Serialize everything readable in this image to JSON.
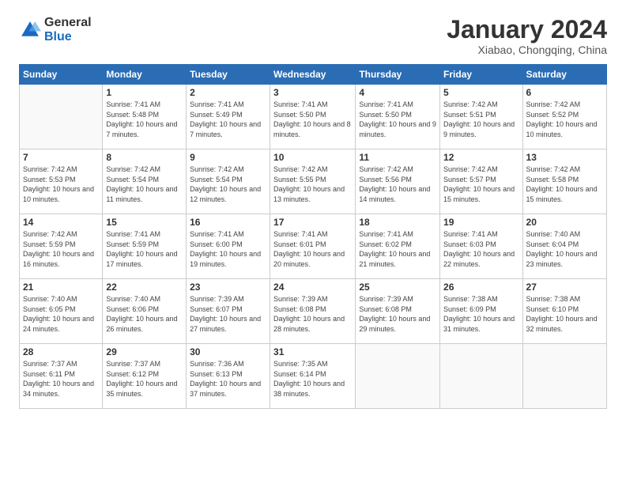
{
  "logo": {
    "general": "General",
    "blue": "Blue"
  },
  "title": "January 2024",
  "subtitle": "Xiabao, Chongqing, China",
  "days_header": [
    "Sunday",
    "Monday",
    "Tuesday",
    "Wednesday",
    "Thursday",
    "Friday",
    "Saturday"
  ],
  "weeks": [
    [
      {
        "day": "",
        "sunrise": "",
        "sunset": "",
        "daylight": ""
      },
      {
        "day": "1",
        "sunrise": "Sunrise: 7:41 AM",
        "sunset": "Sunset: 5:48 PM",
        "daylight": "Daylight: 10 hours and 7 minutes."
      },
      {
        "day": "2",
        "sunrise": "Sunrise: 7:41 AM",
        "sunset": "Sunset: 5:49 PM",
        "daylight": "Daylight: 10 hours and 7 minutes."
      },
      {
        "day": "3",
        "sunrise": "Sunrise: 7:41 AM",
        "sunset": "Sunset: 5:50 PM",
        "daylight": "Daylight: 10 hours and 8 minutes."
      },
      {
        "day": "4",
        "sunrise": "Sunrise: 7:41 AM",
        "sunset": "Sunset: 5:50 PM",
        "daylight": "Daylight: 10 hours and 9 minutes."
      },
      {
        "day": "5",
        "sunrise": "Sunrise: 7:42 AM",
        "sunset": "Sunset: 5:51 PM",
        "daylight": "Daylight: 10 hours and 9 minutes."
      },
      {
        "day": "6",
        "sunrise": "Sunrise: 7:42 AM",
        "sunset": "Sunset: 5:52 PM",
        "daylight": "Daylight: 10 hours and 10 minutes."
      }
    ],
    [
      {
        "day": "7",
        "sunrise": "Sunrise: 7:42 AM",
        "sunset": "Sunset: 5:53 PM",
        "daylight": "Daylight: 10 hours and 10 minutes."
      },
      {
        "day": "8",
        "sunrise": "Sunrise: 7:42 AM",
        "sunset": "Sunset: 5:54 PM",
        "daylight": "Daylight: 10 hours and 11 minutes."
      },
      {
        "day": "9",
        "sunrise": "Sunrise: 7:42 AM",
        "sunset": "Sunset: 5:54 PM",
        "daylight": "Daylight: 10 hours and 12 minutes."
      },
      {
        "day": "10",
        "sunrise": "Sunrise: 7:42 AM",
        "sunset": "Sunset: 5:55 PM",
        "daylight": "Daylight: 10 hours and 13 minutes."
      },
      {
        "day": "11",
        "sunrise": "Sunrise: 7:42 AM",
        "sunset": "Sunset: 5:56 PM",
        "daylight": "Daylight: 10 hours and 14 minutes."
      },
      {
        "day": "12",
        "sunrise": "Sunrise: 7:42 AM",
        "sunset": "Sunset: 5:57 PM",
        "daylight": "Daylight: 10 hours and 15 minutes."
      },
      {
        "day": "13",
        "sunrise": "Sunrise: 7:42 AM",
        "sunset": "Sunset: 5:58 PM",
        "daylight": "Daylight: 10 hours and 15 minutes."
      }
    ],
    [
      {
        "day": "14",
        "sunrise": "Sunrise: 7:42 AM",
        "sunset": "Sunset: 5:59 PM",
        "daylight": "Daylight: 10 hours and 16 minutes."
      },
      {
        "day": "15",
        "sunrise": "Sunrise: 7:41 AM",
        "sunset": "Sunset: 5:59 PM",
        "daylight": "Daylight: 10 hours and 17 minutes."
      },
      {
        "day": "16",
        "sunrise": "Sunrise: 7:41 AM",
        "sunset": "Sunset: 6:00 PM",
        "daylight": "Daylight: 10 hours and 19 minutes."
      },
      {
        "day": "17",
        "sunrise": "Sunrise: 7:41 AM",
        "sunset": "Sunset: 6:01 PM",
        "daylight": "Daylight: 10 hours and 20 minutes."
      },
      {
        "day": "18",
        "sunrise": "Sunrise: 7:41 AM",
        "sunset": "Sunset: 6:02 PM",
        "daylight": "Daylight: 10 hours and 21 minutes."
      },
      {
        "day": "19",
        "sunrise": "Sunrise: 7:41 AM",
        "sunset": "Sunset: 6:03 PM",
        "daylight": "Daylight: 10 hours and 22 minutes."
      },
      {
        "day": "20",
        "sunrise": "Sunrise: 7:40 AM",
        "sunset": "Sunset: 6:04 PM",
        "daylight": "Daylight: 10 hours and 23 minutes."
      }
    ],
    [
      {
        "day": "21",
        "sunrise": "Sunrise: 7:40 AM",
        "sunset": "Sunset: 6:05 PM",
        "daylight": "Daylight: 10 hours and 24 minutes."
      },
      {
        "day": "22",
        "sunrise": "Sunrise: 7:40 AM",
        "sunset": "Sunset: 6:06 PM",
        "daylight": "Daylight: 10 hours and 26 minutes."
      },
      {
        "day": "23",
        "sunrise": "Sunrise: 7:39 AM",
        "sunset": "Sunset: 6:07 PM",
        "daylight": "Daylight: 10 hours and 27 minutes."
      },
      {
        "day": "24",
        "sunrise": "Sunrise: 7:39 AM",
        "sunset": "Sunset: 6:08 PM",
        "daylight": "Daylight: 10 hours and 28 minutes."
      },
      {
        "day": "25",
        "sunrise": "Sunrise: 7:39 AM",
        "sunset": "Sunset: 6:08 PM",
        "daylight": "Daylight: 10 hours and 29 minutes."
      },
      {
        "day": "26",
        "sunrise": "Sunrise: 7:38 AM",
        "sunset": "Sunset: 6:09 PM",
        "daylight": "Daylight: 10 hours and 31 minutes."
      },
      {
        "day": "27",
        "sunrise": "Sunrise: 7:38 AM",
        "sunset": "Sunset: 6:10 PM",
        "daylight": "Daylight: 10 hours and 32 minutes."
      }
    ],
    [
      {
        "day": "28",
        "sunrise": "Sunrise: 7:37 AM",
        "sunset": "Sunset: 6:11 PM",
        "daylight": "Daylight: 10 hours and 34 minutes."
      },
      {
        "day": "29",
        "sunrise": "Sunrise: 7:37 AM",
        "sunset": "Sunset: 6:12 PM",
        "daylight": "Daylight: 10 hours and 35 minutes."
      },
      {
        "day": "30",
        "sunrise": "Sunrise: 7:36 AM",
        "sunset": "Sunset: 6:13 PM",
        "daylight": "Daylight: 10 hours and 37 minutes."
      },
      {
        "day": "31",
        "sunrise": "Sunrise: 7:35 AM",
        "sunset": "Sunset: 6:14 PM",
        "daylight": "Daylight: 10 hours and 38 minutes."
      },
      {
        "day": "",
        "sunrise": "",
        "sunset": "",
        "daylight": ""
      },
      {
        "day": "",
        "sunrise": "",
        "sunset": "",
        "daylight": ""
      },
      {
        "day": "",
        "sunrise": "",
        "sunset": "",
        "daylight": ""
      }
    ]
  ]
}
